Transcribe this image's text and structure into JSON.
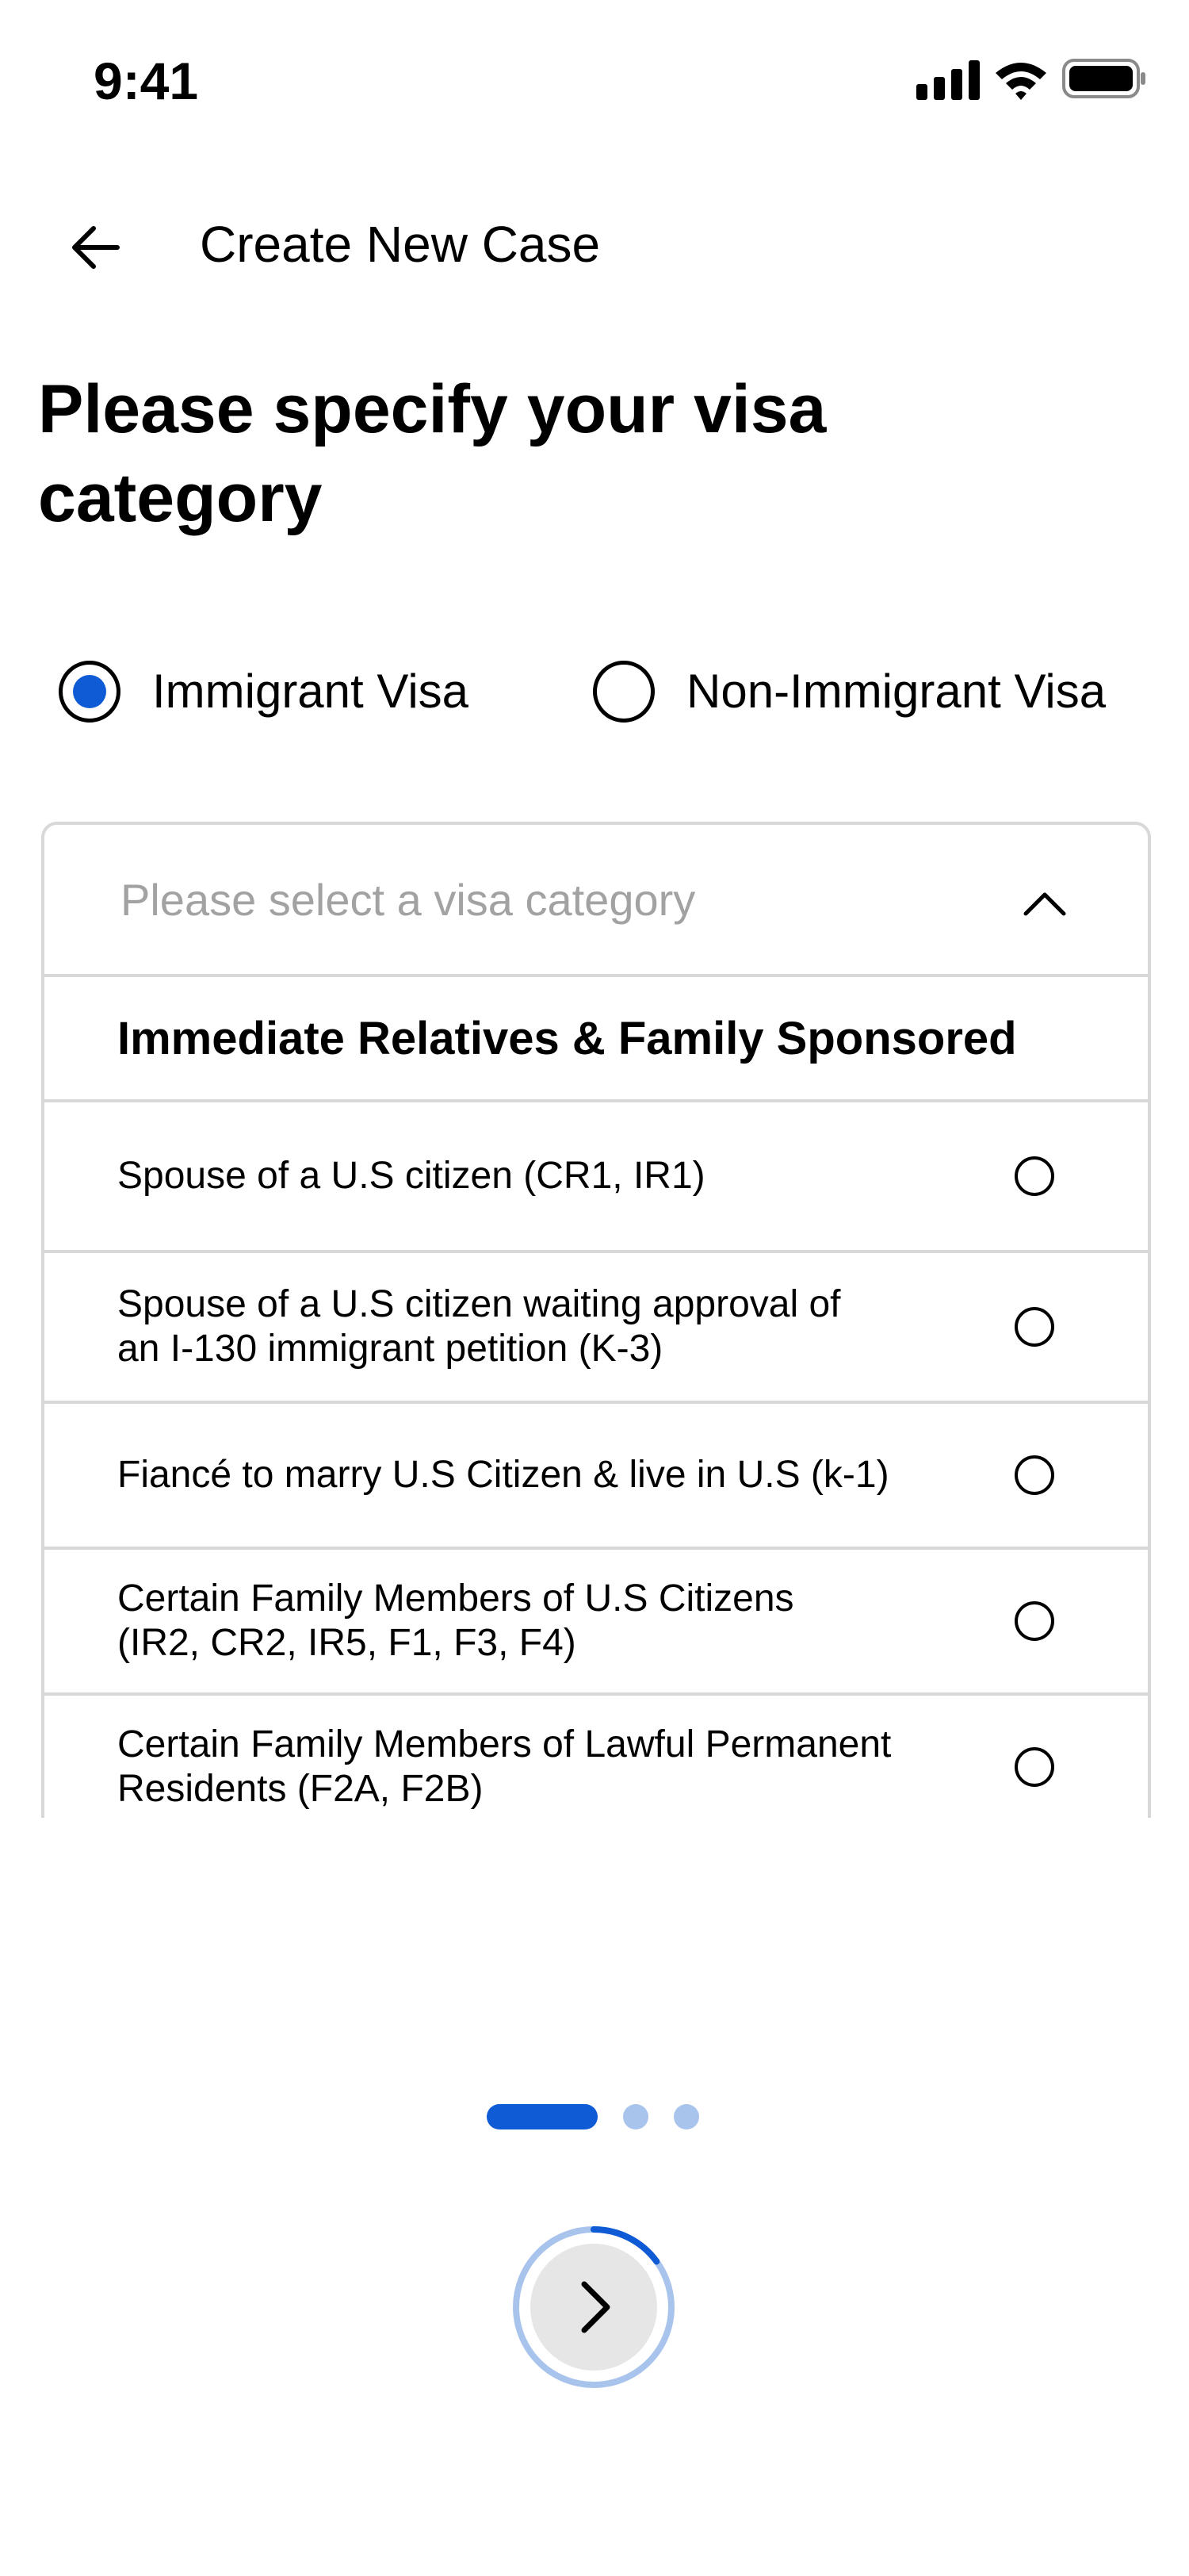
{
  "status_bar": {
    "time": "9:41",
    "icons": [
      "cellular-signal-icon",
      "wifi-icon",
      "battery-icon"
    ]
  },
  "header": {
    "back_icon": "arrow-left-icon",
    "title": "Create New Case"
  },
  "page": {
    "title": "Please specify your visa category"
  },
  "visa_type": {
    "options": [
      {
        "label": "Immigrant Visa",
        "selected": true
      },
      {
        "label": "Non-Immigrant Visa",
        "selected": false
      }
    ]
  },
  "dropdown": {
    "placeholder": "Please select a visa category",
    "expanded": true,
    "chevron_icon": "chevron-up-icon",
    "group_header": "Immediate Relatives & Family Sponsored",
    "options": [
      {
        "line1": "Spouse of a U.S citizen (CR1, IR1)",
        "line2": ""
      },
      {
        "line1": "Spouse of a U.S citizen waiting approval of",
        "line2": "an I-130 immigrant petition (K-3)"
      },
      {
        "line1": "Fiancé to marry U.S Citizen & live in U.S (k-1)",
        "line2": ""
      },
      {
        "line1": "Certain Family Members of U.S Citizens",
        "line2": "(IR2, CR2, IR5, F1, F3, F4)"
      },
      {
        "line1": "Certain Family Members of Lawful Permanent",
        "line2": "Residents (F2A, F2B)"
      }
    ]
  },
  "pagination": {
    "current_page": 1,
    "total_pages": 3
  },
  "next_button": {
    "icon": "chevron-right-icon",
    "progress": 0.15
  },
  "colors": {
    "accent": "#0f5bd6",
    "accent_light": "#a8c4ec",
    "border": "#d8d8d8",
    "placeholder": "#a2a2a2",
    "button_fill": "#e6e6e6"
  }
}
